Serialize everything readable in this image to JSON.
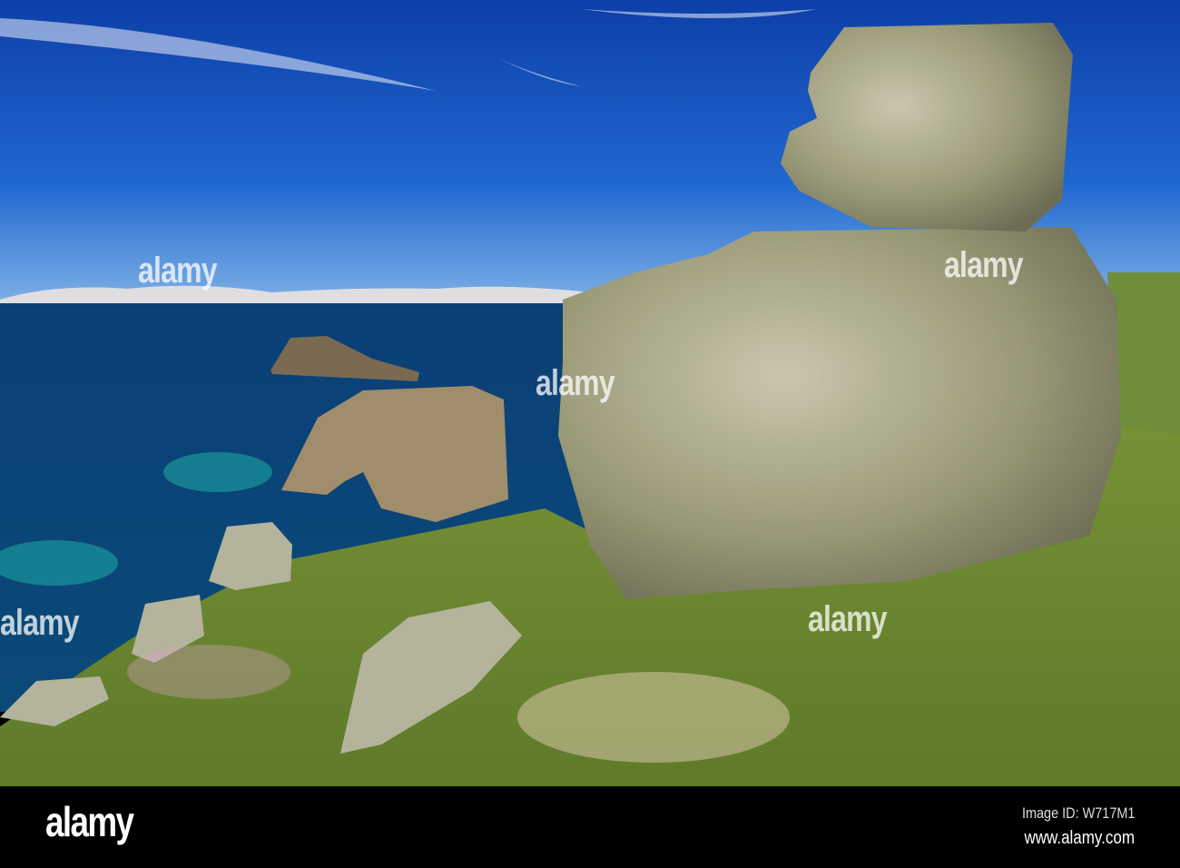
{
  "watermark": "alamy",
  "footer": {
    "logo": "alamy",
    "image_id": "Image ID: W717M1",
    "website": "www.alamy.com"
  }
}
